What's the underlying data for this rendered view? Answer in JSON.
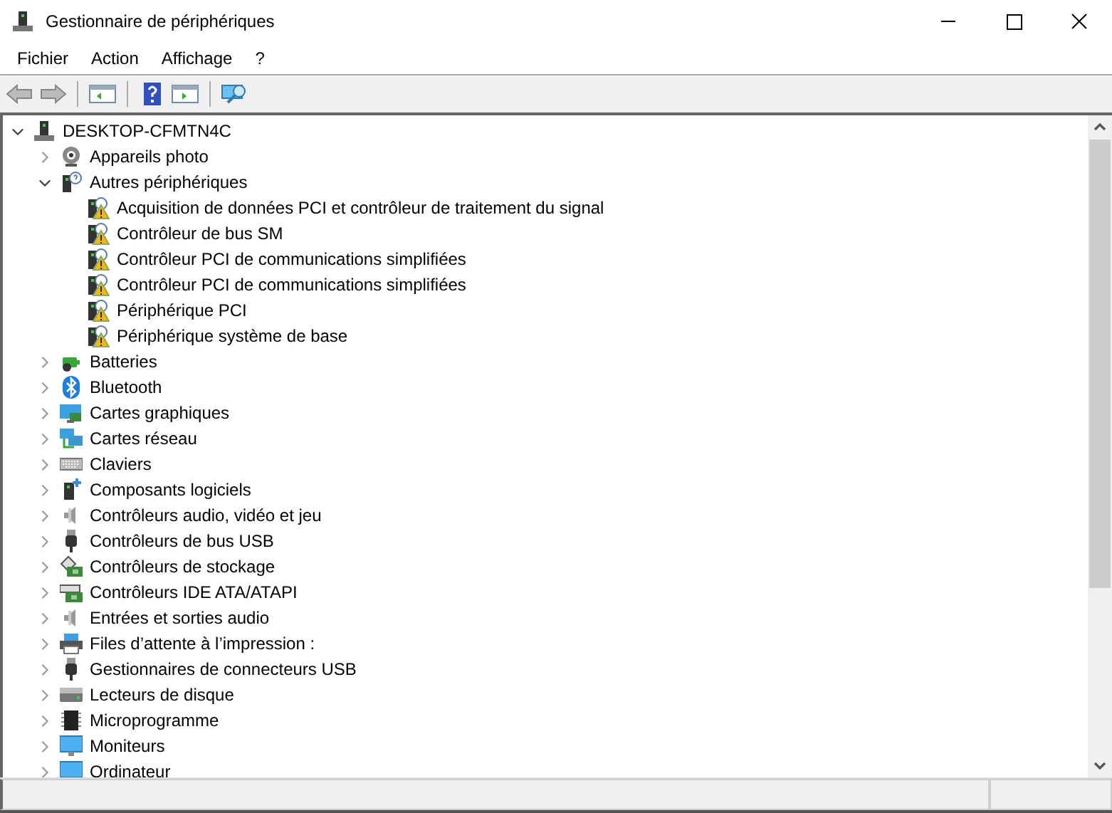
{
  "window": {
    "title": "Gestionnaire de périphériques"
  },
  "menu": [
    "Fichier",
    "Action",
    "Affichage",
    "?"
  ],
  "tree": {
    "label": "DESKTOP-CFMTN4C",
    "kind": "computer",
    "expanded": true,
    "children": [
      {
        "label": "Appareils photo",
        "kind": "camera",
        "expanded": false
      },
      {
        "label": "Autres périphériques",
        "kind": "unknown",
        "expanded": true,
        "children": [
          {
            "label": "Acquisition de données PCI et contrôleur de traitement du signal",
            "kind": "warning"
          },
          {
            "label": "Contrôleur de bus SM",
            "kind": "warning"
          },
          {
            "label": "Contrôleur PCI de communications simplifiées",
            "kind": "warning"
          },
          {
            "label": "Contrôleur PCI de communications simplifiées",
            "kind": "warning"
          },
          {
            "label": "Périphérique PCI",
            "kind": "warning"
          },
          {
            "label": "Périphérique système de base",
            "kind": "warning"
          }
        ]
      },
      {
        "label": "Batteries",
        "kind": "battery",
        "expanded": false
      },
      {
        "label": "Bluetooth",
        "kind": "bluetooth",
        "expanded": false
      },
      {
        "label": "Cartes graphiques",
        "kind": "display",
        "expanded": false
      },
      {
        "label": "Cartes réseau",
        "kind": "network",
        "expanded": false
      },
      {
        "label": "Claviers",
        "kind": "keyboard",
        "expanded": false
      },
      {
        "label": "Composants logiciels",
        "kind": "software",
        "expanded": false
      },
      {
        "label": "Contrôleurs audio, vidéo et jeu",
        "kind": "audio",
        "expanded": false
      },
      {
        "label": "Contrôleurs de bus USB",
        "kind": "usb",
        "expanded": false
      },
      {
        "label": "Contrôleurs de stockage",
        "kind": "storage",
        "expanded": false
      },
      {
        "label": "Contrôleurs IDE ATA/ATAPI",
        "kind": "ide",
        "expanded": false
      },
      {
        "label": "Entrées et sorties audio",
        "kind": "audio",
        "expanded": false
      },
      {
        "label": "Files d’attente à l’impression :",
        "kind": "printer",
        "expanded": false
      },
      {
        "label": "Gestionnaires de connecteurs USB",
        "kind": "usb",
        "expanded": false
      },
      {
        "label": "Lecteurs de disque",
        "kind": "disk",
        "expanded": false
      },
      {
        "label": "Microprogramme",
        "kind": "chip",
        "expanded": false
      },
      {
        "label": "Moniteurs",
        "kind": "monitor",
        "expanded": false
      },
      {
        "label": "Ordinateur",
        "kind": "monitor",
        "expanded": false
      }
    ]
  }
}
